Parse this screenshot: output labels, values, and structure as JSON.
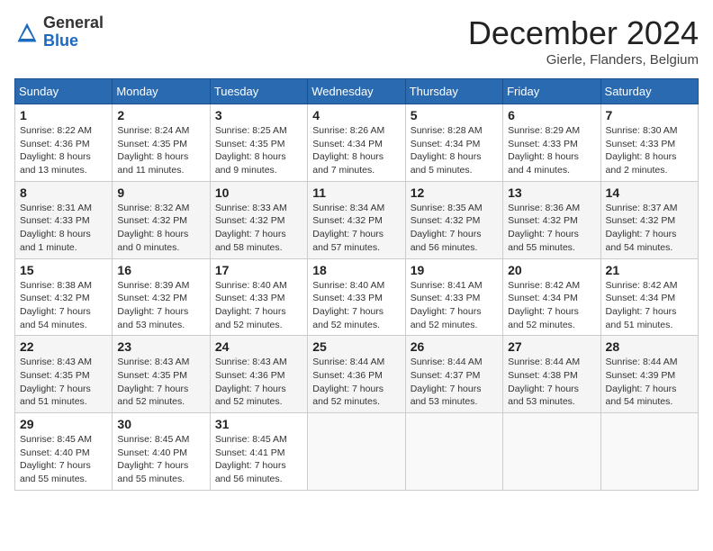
{
  "header": {
    "logo_general": "General",
    "logo_blue": "Blue",
    "month_title": "December 2024",
    "location": "Gierle, Flanders, Belgium"
  },
  "days_of_week": [
    "Sunday",
    "Monday",
    "Tuesday",
    "Wednesday",
    "Thursday",
    "Friday",
    "Saturday"
  ],
  "weeks": [
    [
      {
        "day": "1",
        "sunrise": "8:22 AM",
        "sunset": "4:36 PM",
        "daylight": "8 hours and 13 minutes."
      },
      {
        "day": "2",
        "sunrise": "8:24 AM",
        "sunset": "4:35 PM",
        "daylight": "8 hours and 11 minutes."
      },
      {
        "day": "3",
        "sunrise": "8:25 AM",
        "sunset": "4:35 PM",
        "daylight": "8 hours and 9 minutes."
      },
      {
        "day": "4",
        "sunrise": "8:26 AM",
        "sunset": "4:34 PM",
        "daylight": "8 hours and 7 minutes."
      },
      {
        "day": "5",
        "sunrise": "8:28 AM",
        "sunset": "4:34 PM",
        "daylight": "8 hours and 5 minutes."
      },
      {
        "day": "6",
        "sunrise": "8:29 AM",
        "sunset": "4:33 PM",
        "daylight": "8 hours and 4 minutes."
      },
      {
        "day": "7",
        "sunrise": "8:30 AM",
        "sunset": "4:33 PM",
        "daylight": "8 hours and 2 minutes."
      }
    ],
    [
      {
        "day": "8",
        "sunrise": "8:31 AM",
        "sunset": "4:33 PM",
        "daylight": "8 hours and 1 minute."
      },
      {
        "day": "9",
        "sunrise": "8:32 AM",
        "sunset": "4:32 PM",
        "daylight": "8 hours and 0 minutes."
      },
      {
        "day": "10",
        "sunrise": "8:33 AM",
        "sunset": "4:32 PM",
        "daylight": "7 hours and 58 minutes."
      },
      {
        "day": "11",
        "sunrise": "8:34 AM",
        "sunset": "4:32 PM",
        "daylight": "7 hours and 57 minutes."
      },
      {
        "day": "12",
        "sunrise": "8:35 AM",
        "sunset": "4:32 PM",
        "daylight": "7 hours and 56 minutes."
      },
      {
        "day": "13",
        "sunrise": "8:36 AM",
        "sunset": "4:32 PM",
        "daylight": "7 hours and 55 minutes."
      },
      {
        "day": "14",
        "sunrise": "8:37 AM",
        "sunset": "4:32 PM",
        "daylight": "7 hours and 54 minutes."
      }
    ],
    [
      {
        "day": "15",
        "sunrise": "8:38 AM",
        "sunset": "4:32 PM",
        "daylight": "7 hours and 54 minutes."
      },
      {
        "day": "16",
        "sunrise": "8:39 AM",
        "sunset": "4:32 PM",
        "daylight": "7 hours and 53 minutes."
      },
      {
        "day": "17",
        "sunrise": "8:40 AM",
        "sunset": "4:33 PM",
        "daylight": "7 hours and 52 minutes."
      },
      {
        "day": "18",
        "sunrise": "8:40 AM",
        "sunset": "4:33 PM",
        "daylight": "7 hours and 52 minutes."
      },
      {
        "day": "19",
        "sunrise": "8:41 AM",
        "sunset": "4:33 PM",
        "daylight": "7 hours and 52 minutes."
      },
      {
        "day": "20",
        "sunrise": "8:42 AM",
        "sunset": "4:34 PM",
        "daylight": "7 hours and 52 minutes."
      },
      {
        "day": "21",
        "sunrise": "8:42 AM",
        "sunset": "4:34 PM",
        "daylight": "7 hours and 51 minutes."
      }
    ],
    [
      {
        "day": "22",
        "sunrise": "8:43 AM",
        "sunset": "4:35 PM",
        "daylight": "7 hours and 51 minutes."
      },
      {
        "day": "23",
        "sunrise": "8:43 AM",
        "sunset": "4:35 PM",
        "daylight": "7 hours and 52 minutes."
      },
      {
        "day": "24",
        "sunrise": "8:43 AM",
        "sunset": "4:36 PM",
        "daylight": "7 hours and 52 minutes."
      },
      {
        "day": "25",
        "sunrise": "8:44 AM",
        "sunset": "4:36 PM",
        "daylight": "7 hours and 52 minutes."
      },
      {
        "day": "26",
        "sunrise": "8:44 AM",
        "sunset": "4:37 PM",
        "daylight": "7 hours and 53 minutes."
      },
      {
        "day": "27",
        "sunrise": "8:44 AM",
        "sunset": "4:38 PM",
        "daylight": "7 hours and 53 minutes."
      },
      {
        "day": "28",
        "sunrise": "8:44 AM",
        "sunset": "4:39 PM",
        "daylight": "7 hours and 54 minutes."
      }
    ],
    [
      {
        "day": "29",
        "sunrise": "8:45 AM",
        "sunset": "4:40 PM",
        "daylight": "7 hours and 55 minutes."
      },
      {
        "day": "30",
        "sunrise": "8:45 AM",
        "sunset": "4:40 PM",
        "daylight": "7 hours and 55 minutes."
      },
      {
        "day": "31",
        "sunrise": "8:45 AM",
        "sunset": "4:41 PM",
        "daylight": "7 hours and 56 minutes."
      },
      null,
      null,
      null,
      null
    ]
  ],
  "label_sunrise": "Sunrise:",
  "label_sunset": "Sunset:",
  "label_daylight": "Daylight:"
}
